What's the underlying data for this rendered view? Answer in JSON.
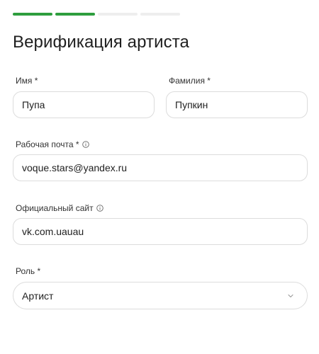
{
  "progress": {
    "total_steps": 4,
    "completed_steps": 2
  },
  "title": "Верификация артиста",
  "form": {
    "first_name": {
      "label": "Имя *",
      "value": "Пупа"
    },
    "last_name": {
      "label": "Фамилия *",
      "value": "Пупкин"
    },
    "work_email": {
      "label": "Рабочая почта *",
      "value": "voque.stars@yandex.ru",
      "icon": "info-icon"
    },
    "website": {
      "label": "Официальный сайт",
      "value": "vk.com.uauau",
      "icon": "info-icon"
    },
    "role": {
      "label": "Роль *",
      "value": "Артист",
      "icon": "chevron-down-icon"
    }
  },
  "colors": {
    "accent": "#2e9e3e",
    "border": "#dcdcdc"
  }
}
